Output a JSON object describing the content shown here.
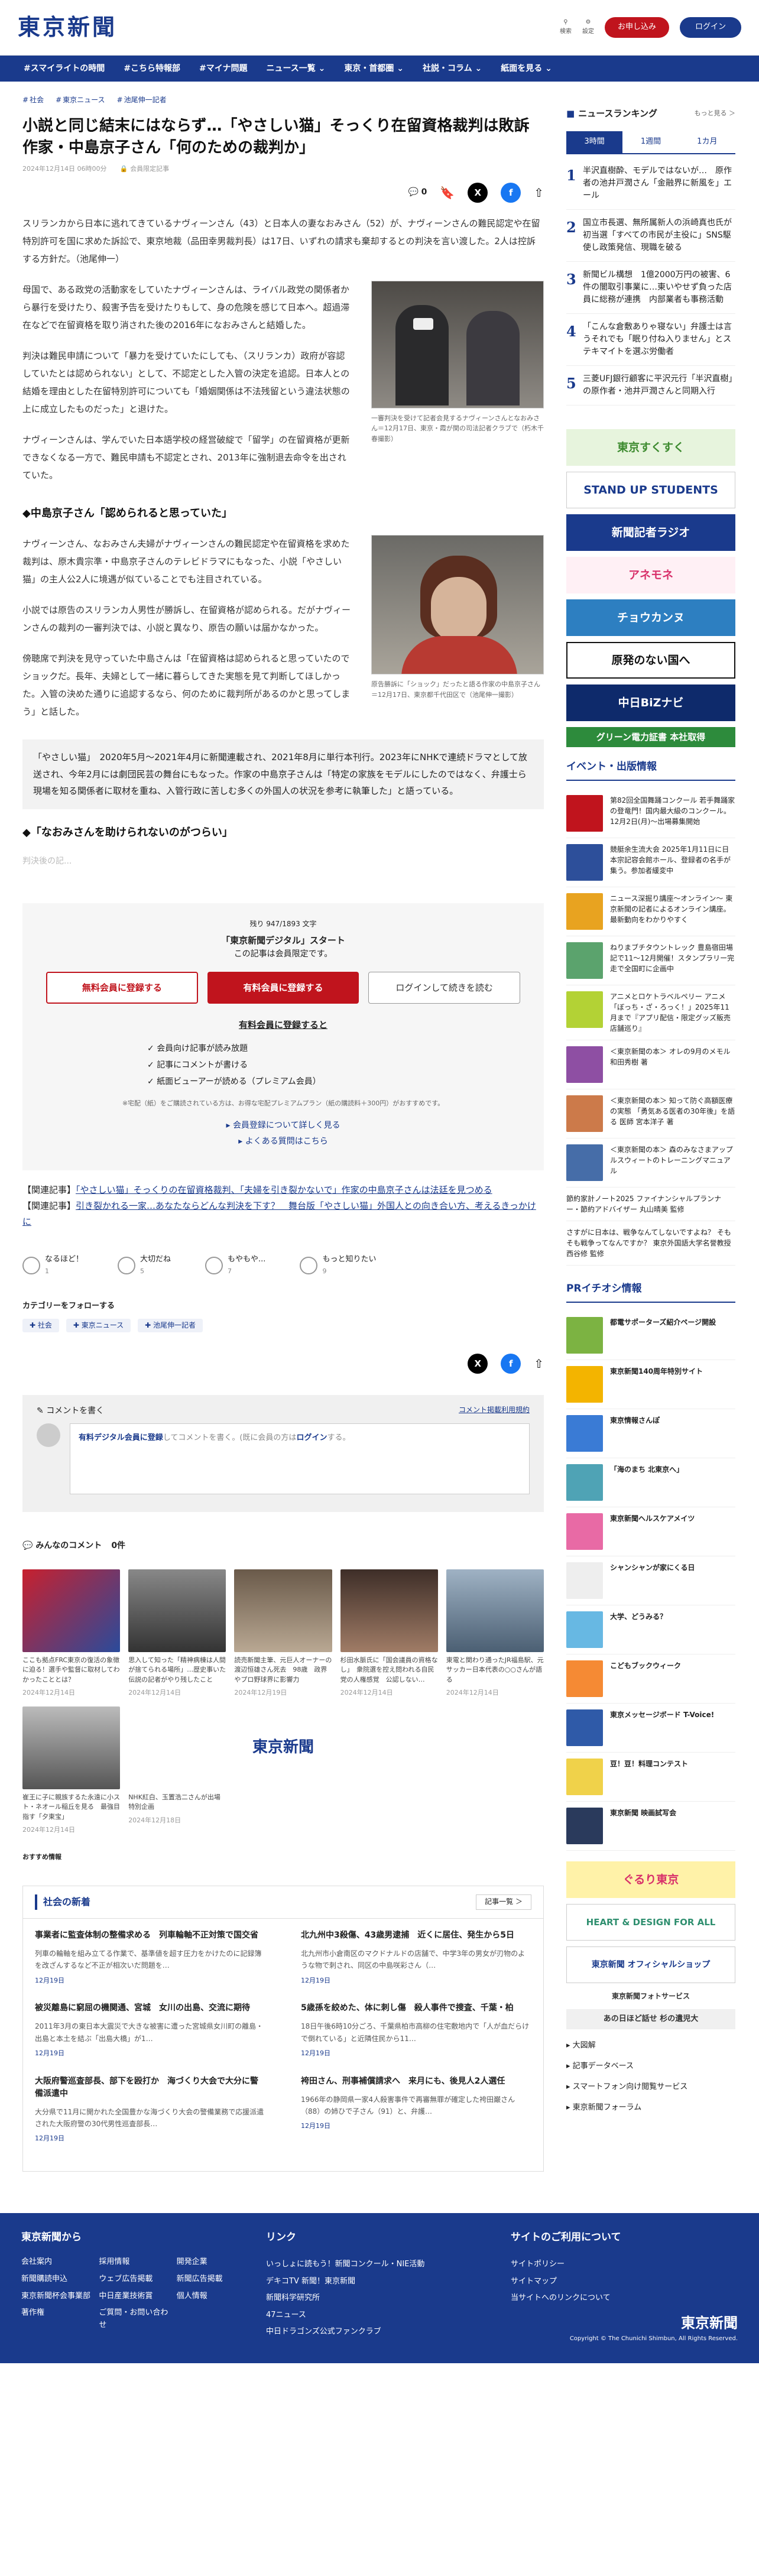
{
  "header": {
    "logo": "東京新聞",
    "search": "検索",
    "settings": "設定",
    "register": "お申し込み",
    "login": "ログイン"
  },
  "nav": [
    "#スマイライトの時間",
    "#こちら特報部",
    "#マイナ問題",
    "ニュース一覧 ⌄",
    "東京・首都圏 ⌄",
    "社説・コラム ⌄",
    "紙面を見る ⌄"
  ],
  "article": {
    "crumbs": [
      "社会",
      "東京ニュース",
      "池尾伸一記者"
    ],
    "title": "小説と同じ結末にはならず…「やさしい猫」そっくり在留資格裁判は敗訴　作家・中島京子さん「何のための裁判か」",
    "date": "2024年12月14日 06時00分",
    "badge": "会員限定記事",
    "comments_count": "0",
    "lead": "スリランカから日本に逃れてきているナヴィーンさん（43）と日本人の妻なおみさん（52）が、ナヴィーンさんの難民認定や在留特別許可を国に求めた訴訟で、東京地裁（品田幸男裁判長）は17日、いずれの請求も棄却するとの判決を言い渡した。2人は控訴する方針だ。（池尾伸一）",
    "p1": "母国で、ある政党の活動家をしていたナヴィーンさんは、ライバル政党の関係者から暴行を受けたり、殺害予告を受けたりもして、身の危険を感じて日本へ。超過滞在などで在留資格を取り消された後の2016年になおみさんと結婚した。",
    "p2": "判決は難民申請について「暴力を受けていたにしても、（スリランカ）政府が容認していたとは認められない」として、不認定とした入管の決定を追認。日本人との結婚を理由とした在留特別許可についても「婚姻関係は不法残留という違法状態の上に成立したものだった」と退けた。",
    "p3": "ナヴィーンさんは、学んでいた日本語学校の経営破綻で「留学」の在留資格が更新できなくなる一方で、難民申請も不認定とされ、2013年に強制退去命令を出されていた。",
    "cap1": "一審判決を受けて記者会見するナヴィーンさんとなおみさん＝12月17日、東京・霞が関の司法記者クラブで（朽木千春撮影）",
    "h_nakajima": "◆中島京子さん「認められると思っていた」",
    "p4": "ナヴィーンさん、なおみさん夫婦がナヴィーンさんの難民認定や在留資格を求めた裁判は、原木貴宗準・中島京子さんのテレビドラマにもなった、小説「やさしい猫」の主人公2人に境遇が似ていることでも注目されている。",
    "p5": "小説では原告のスリランカ人男性が勝訴し、在留資格が認められる。だがナヴィーンさんの裁判の一審判決では、小説と異なり、原告の願いは届かなかった。",
    "p6": "傍聴席で判決を見守っていた中島さんは「在留資格は認められると思っていたのでショックだ。長年、夫婦として一緒に暮らしてきた実態を見て判断してほしかった。入管の決めた通りに追認するなら、何のために裁判所があるのかと思ってしまう」と話した。",
    "cap2": "原告勝訴に「ショック」だったと語る作家の中島京子さん＝12月17日、東京都千代田区で（池尾伸一撮影）",
    "box": "「やさしい猫」　2020年5月〜2021年4月に新聞連載され、2021年8月に単行本刊行。2023年にNHKで連続ドラマとして放送され、今年2月には劇団民芸の舞台にもなった。作家の中島京子さんは「特定の家族をモデルにしたのではなく、弁護士ら現場を知る関係者に取材を重ね、入管行政に苦しむ多くの外国人の状況を参考に執筆した」と語っている。",
    "h3": "◆「なおみさんを助けられないのがつらい」",
    "rest": "判決後の記..."
  },
  "paywall": {
    "count": "残り 947/1893 文字",
    "title": "「東京新聞デジタル」スタート",
    "sub": "この記事は会員限定です。",
    "btn_free": "無料会員に登録する",
    "btn_paid": "有料会員に登録する",
    "btn_login": "ログインして続きを読む",
    "benefits_title": "有料会員に登録すると",
    "benefits": [
      "会員向け記事が読み放題",
      "記事にコメントが書ける",
      "紙面ビューアーが読める（プレミアム会員）"
    ],
    "note": "※宅配（紙）をご購読されている方は、お得な宅配プレミアムプラン（紙の購読料＋300円）がおすすめです。",
    "link1": "会員登録について詳しく見る",
    "link2": "よくある質問はこちら"
  },
  "related": {
    "prefix1": "【関連記事】",
    "link1": "「やさしい猫」そっくりの在留資格裁判、「夫婦を引き裂かないで」作家の中島京子さんは法廷を見つめる",
    "prefix2": "【関連記事】",
    "link2": "引き裂かれる一家…あなたならどんな判決を下す？　舞台版「やさしい猫」外国人との向き合い方、考えるきっかけに"
  },
  "reactions": [
    {
      "label": "なるほど！",
      "count": "1"
    },
    {
      "label": "大切だね",
      "count": "5"
    },
    {
      "label": "もやもや...",
      "count": "7"
    },
    {
      "label": "もっと知りたい",
      "count": "9"
    }
  ],
  "follow": {
    "title": "カテゴリーをフォローする",
    "tags": [
      "社会",
      "東京ニュース",
      "池尾伸一記者"
    ]
  },
  "comment": {
    "title": "コメントを書く",
    "policy": "コメント掲載利用規約",
    "prompt_a": "有料デジタル会員に登録",
    "prompt_b": "してコメントを書く。(既に会員の方は",
    "prompt_c": "ログイン",
    "prompt_d": "する。"
  },
  "everyone": {
    "title": "みんなのコメント",
    "count": "0件"
  },
  "gallery": [
    {
      "cap": "ここも拠点FRC東京の復活の象徴に迫る！選手や監督に取材してわかったこととは？",
      "date": "2024年12月14日"
    },
    {
      "cap": "思入して知った「精神病棟は人間が捨てられる場所」…歴史事いた伝説の記者がやり残したこと",
      "date": "2024年12月14日"
    },
    {
      "cap": "読売新聞主筆、元巨人オーナーの渡辺恒雄さん死去　98歳　政界やプロ野球界に影響力",
      "date": "2024年12月19日"
    },
    {
      "cap": "杉田水脈氏に「国会議員の資格なし」　衆院選を控え問われる自民党の人権感覚　公認しない…",
      "date": "2024年12月14日"
    },
    {
      "cap": "東電と関わり通ったJR福島駅、元サッカー日本代表の○○さんが語る",
      "date": "2024年12月14日"
    },
    {
      "cap": "崔王に子に親族するた永遠に小スト・ネオール稲丘を見る　最強目指す「夕東宝」",
      "date": "2024年12月14日"
    },
    {
      "cap": "NHK紅白、玉置浩二さんが出場　特別企画",
      "date": "2024年12月18日"
    },
    {
      "cap": "東京新聞",
      "date": ""
    }
  ],
  "recommend": "おすすめ情報",
  "newsbox": {
    "title": "社会の新着",
    "more": "記事一覧 ＞",
    "items": [
      {
        "h": "事業者に監査体制の整備求める　列車輪軸不正対策で国交省",
        "p": "列車の輪軸を組み立てる作業で、基準値を超す圧力をかけたのに記録簿を改ざんするなど不正が相次いだ問題を…",
        "d": "12月19日"
      },
      {
        "h": "北九州中3殺傷、43歳男逮捕　近くに居住、発生から5日",
        "p": "北九州市小倉南区のマクドナルドの店舗で、中学3年の男女が刃物のような物で刺され、同区の中島咲彩さん（…",
        "d": "12月19日"
      },
      {
        "h": "被災離島に窮屈の機関通、宮城　女川の出島、交流に期待",
        "p": "2011年3月の東日本大震災で大きな被害に遭った宮城県女川町の離島・出島と本土を結ぶ「出島大橋」が1…",
        "d": "12月19日"
      },
      {
        "h": "5歳孫を絞めた、体に刺し傷　殺人事件で捜査、千葉・柏",
        "p": "18日午後6時10分ごろ、千葉県柏市高柳の住宅敷地内で「人が血だらけで倒れている」と近隣住民から11…",
        "d": "12月19日"
      },
      {
        "h": "大阪府警巡査部長、部下を殴打か　海づくり大会で大分に警備派遣中",
        "p": "大分県で11月に開かれた全国豊かな海づくり大会の警備業務で応援派遣された大阪府警の30代男性巡査部長…",
        "d": "12月19日"
      },
      {
        "h": "袴田さん、刑事補償請求へ　来月にも、後見人2人選任",
        "p": "1966年の静岡県一家4人殺害事件で再審無罪が確定した袴田巌さん（88）の姉ひで子さん（91）と、弁護…",
        "d": "12月19日"
      }
    ]
  },
  "side": {
    "rank_title": "ニュースランキング",
    "rank_more": "もっと見る ＞",
    "tabs": [
      "3時間",
      "1週間",
      "1カ月"
    ],
    "ranks": [
      "半沢直樹酔、モデルではないが…　原作者の池井戸潤さん「金融界に新風を」エール",
      "国立市長選、無所属新人の浜崎真也氏が初当選「すべての市民が主役に」SNS駆使し政策発信、現職を破る",
      "新聞ビル構想　1億2000万円の被害、6件の闇取引事業に…東いやせず負った店員に総務が連携　内部業者も事務活動",
      "「こんな倉敷ありゃ寝ない」弁護士は言うそれでも「眠り付ね入りません」とステキマイトを選ぶ労働者",
      "三菱UFJ銀行顧客に平沢元行「半沢直樹」の原作者・池井戸潤さんと同期入行"
    ],
    "banners": [
      "東京すくすく",
      "STAND UP STUDENTS",
      "新聞記者ラジオ",
      "アネモネ",
      "チョウカンヌ",
      "原発のない国へ",
      "中日BiZナビ",
      "グリーン電力証書 本社取得"
    ],
    "events_title": "イベント・出版情報",
    "events": [
      "第82回全国舞踊コンクール 若手舞踊家の登竜門！国内最大級のコンクール。12月2日(月)～出場募集開始",
      "競艇余生流大会 2025年1月11日に日本宗記容会館ホール、登録者の名手が集う。参加者緩変中",
      "ニュース深掘り講座～オンライン～ 東京新聞の記者によるオンライン講座。最新動向をわかりやすく",
      "ねりまブチタウントレック 豊島宿田場記で11〜12月開催！スタンプラリー完走で全国町に企画中",
      "アニメとロケトラベルペリー アニメ「ぼっち・ざ・ろっく！」2025年11月まで『アプリ配信・限定グッズ販売店舗巡り』",
      "＜東京新聞の本＞ オレの9月のメモル 和田秀樹 著",
      "＜東京新聞の本＞ 知って防ぐ高額医療の実態 「勇気ある医者の30年後」を語る 医師 宮本洋子 著",
      "＜東京新聞の本＞ 森のみなさまアップルスウィートのトレーニングマニュアル",
      "節約家計ノート2025 ファイナンシャルプランナー・節約アドバイザー 丸山晴美 監修",
      "さすがに日本は、戦争なんてしないですよね？ そもそも戦争ってなんですか？ 東京外国語大学名誉教授 西谷修 監修"
    ],
    "pr_title": "PRイチオシ情報",
    "prs": [
      "都電サポーターズ紹介ページ開設",
      "東京新聞140周年特別サイト",
      "東京情報さんぽ",
      "「海のまち 北東京へ」",
      "東京新聞ヘルスケアメイツ",
      "シャンシャンが家にくる日",
      "大学、どうみる？",
      "こどもブックウィーク",
      "東京メッセージボード T-Voice!",
      "豆！豆！料理コンテスト",
      "東京新聞 映画試写会"
    ],
    "side_banners": [
      "ぐるり東京",
      "HEART & DESIGN FOR ALL",
      "東京新聞 オフィシャルショップ",
      "東京新聞フォトサービス",
      "あの日ほど話せ 杉の遺児大"
    ],
    "links": [
      "大図解",
      "記事データベース",
      "スマートフォン向け閲覧サービス",
      "東京新聞フォーラム"
    ]
  },
  "footer": {
    "c1": "東京新聞から",
    "c1items": [
      "会社案内",
      "採用情報",
      "開発企業",
      "新聞購読申込",
      "ウェブ広告掲載",
      "新聞広告掲載",
      "東京新聞杯会事業部",
      "中日産業技術賞",
      "個人情報",
      "著作権",
      "ご質問・お問い合わせ"
    ],
    "c2": "リンク",
    "c2items": [
      "いっしょに読もう！新聞コンクール・NIE活動",
      "デキコTV 新聞！東京新聞",
      "新聞科学研究所",
      "47ニュース",
      "中日ドラゴンズ公式ファンクラブ"
    ],
    "c3": "サイトのご利用について",
    "c3items": [
      "サイトポリシー",
      "サイトマップ",
      "当サイトへのリンクについて"
    ],
    "logo": "東京新聞",
    "copy": "Copyright © The Chunichi Shimbun, All Rights Reserved."
  }
}
